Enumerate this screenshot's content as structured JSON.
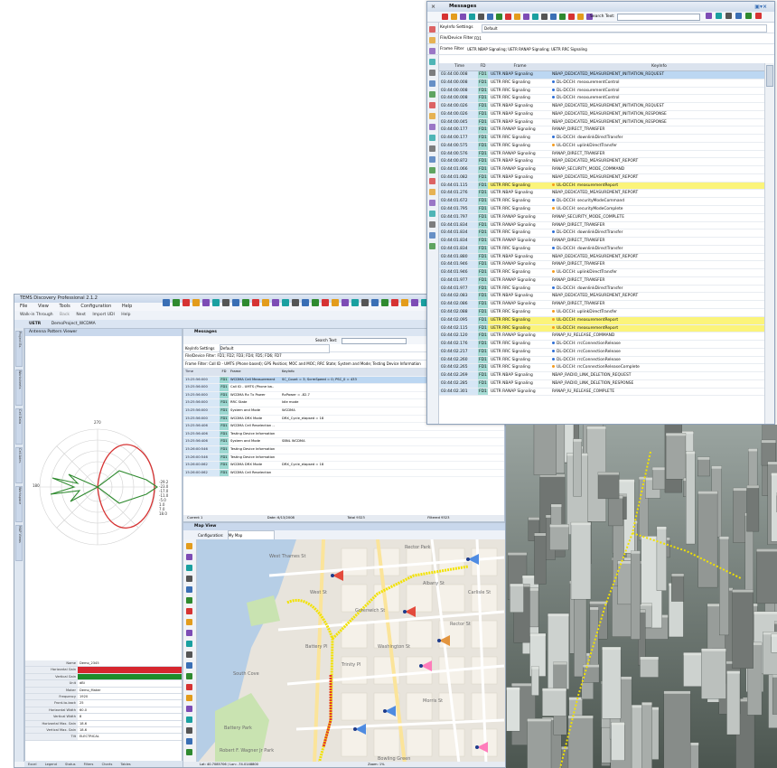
{
  "left_app": {
    "title": "TEMS Discovery Professional 2.1.2",
    "menu": [
      "File",
      "View",
      "Tools",
      "Configuration",
      "Help"
    ],
    "toolbar": {
      "walk": "Walk-in Through",
      "back": "Back",
      "next": "Next",
      "import": "Import UDI",
      "help": "Help"
    },
    "tabs": [
      "UETR",
      "DemoProject_WCDMA"
    ],
    "sidebar_tabs": [
      "Project Ex.",
      "Worksheets",
      "Cell Data",
      "Cell Adm.",
      "Workspace",
      "MAP Views"
    ],
    "antenna_panel": {
      "title": "Antenna Pattern Viewer",
      "polar_top": "270",
      "polar_left": "180",
      "ring_labels": [
        "-29.2",
        "-23.0",
        "-17.0",
        "-11.0",
        "-5.0",
        "1.0",
        "7.0",
        "18.0"
      ],
      "properties": [
        {
          "k": "Name",
          "v": "Demo_2345"
        },
        {
          "k": "Horizontal Gain",
          "v": ""
        },
        {
          "k": "Vertical Gain",
          "v": ""
        },
        {
          "k": "Unit",
          "v": "dBi"
        },
        {
          "k": "Maker",
          "v": "Demo_Maker"
        },
        {
          "k": "Frequency",
          "v": "1920"
        },
        {
          "k": "Front-to-back",
          "v": "25"
        },
        {
          "k": "Horizontal Width",
          "v": "60.0"
        },
        {
          "k": "Vertical Width",
          "v": "8"
        },
        {
          "k": "Horizontal Max. Gain",
          "v": "18.6"
        },
        {
          "k": "Vertical Max. Gain",
          "v": "18.6"
        },
        {
          "k": "Tilt",
          "v": "ELECTRICAL"
        }
      ],
      "bottom_tabs": [
        "Excel",
        "Legend",
        "Status",
        "Filters",
        "Charts",
        "Tables"
      ]
    },
    "messages_panel": {
      "title": "Messages",
      "search_label": "Search Text:",
      "keyinfo_label": "KeyInfo Settings",
      "keyinfo_value": "Default",
      "device_filter": "File/Device Filter: FD1; FD2; FD3; FD4; FD5; FD6; FD7",
      "frame_filter": "Frame Filter: Call ID - UMTS (Phone based); GPS Position; MOC and MOC; RRC State; System and Mode; Testing Device Information",
      "columns": [
        "Time",
        "FD",
        "Frame",
        "KeyInfo"
      ],
      "rows": [
        {
          "t": "15:25:56:000",
          "fd": "FD1",
          "frame": "WCDMA Cell Measurement",
          "info": "SC_Count = 3; ScrmSpeed = 0; PSC_0 = 433"
        },
        {
          "t": "15:25:56:000",
          "fd": "FD1",
          "frame": "Call ID - UMTS (Phone ba..",
          "info": ""
        },
        {
          "t": "15:25:56:000",
          "fd": "FD1",
          "frame": "WCDMA Rx Tx Power",
          "info": "RxPower = -82.7"
        },
        {
          "t": "15:25:56:000",
          "fd": "FD1",
          "frame": "RRC State",
          "info": "Idle mode"
        },
        {
          "t": "15:25:56:000",
          "fd": "FD1",
          "frame": "System and Mode",
          "info": "WCDMA"
        },
        {
          "t": "15:25:56:000",
          "fd": "FD1",
          "frame": "WCDMA DRX Mode",
          "info": "DRX_Cycle_elapsed = 18"
        },
        {
          "t": "15:25:56:406",
          "fd": "FD1",
          "frame": "WCDMA Cell Reselection ..",
          "info": ""
        },
        {
          "t": "15:25:56:406",
          "fd": "FD1",
          "frame": "Testing Device Information",
          "info": ""
        },
        {
          "t": "15:25:56:406",
          "fd": "FD1",
          "frame": "System and Mode",
          "info": "SBNL WCDMA"
        },
        {
          "t": "15:26:00:546",
          "fd": "FD1",
          "frame": "Testing Device Information",
          "info": ""
        },
        {
          "t": "15:26:00:546",
          "fd": "FD1",
          "frame": "Testing Device Information",
          "info": ""
        },
        {
          "t": "15:26:00:062",
          "fd": "FD1",
          "frame": "WCDMA DRX Mode",
          "info": "DRX_Cycle_elapsed = 18"
        },
        {
          "t": "15:26:00:062",
          "fd": "FD1",
          "frame": "WCDMA Cell Reselection",
          "info": ""
        }
      ],
      "footer": [
        "Current 1",
        "Date: 6/13/2008",
        "Total 9323",
        "Filtered 9323"
      ]
    },
    "map_view": {
      "title": "Map View",
      "config_label": "Configuration:",
      "config_value": "My Map",
      "status": "Lat: 40.7085706 / Lon: -74.0148800",
      "status_right": "Zoom: 1%",
      "labels": [
        "Battery Park",
        "South Cove",
        "Robert F. Wagner Jr Park",
        "Battery Pl",
        "West St",
        "Bowling Green",
        "Rector Park",
        "Albany St",
        "Carlisle St",
        "Trinity Pl",
        "Greenwich St",
        "Rector St",
        "Morris St",
        "Washington St",
        "West Thames St"
      ]
    }
  },
  "messages_window": {
    "title": "Messages",
    "search_label": "Search Text:",
    "keyinfo_label": "KeyInfo Settings",
    "keyinfo_value": "Default",
    "device_filter_label": "File/Device Filter",
    "device_filter_value": "FD1",
    "frame_filter_label": "Frame Filter",
    "frame_filter_value": "UETR NBAP Signaling; UETR RANAP Signaling; UETR RRC Signaling",
    "columns": [
      "Time",
      "FD",
      "Frame",
      "KeyInfo"
    ],
    "rows": [
      {
        "t": "03:44:00.008",
        "fd": "FD1",
        "frame": "UETR NBAP Signaling",
        "info": "NBAP_DEDICATED_MEASUREMENT_INITIATION_REQUEST",
        "dot": "",
        "sel": true,
        "hl": false
      },
      {
        "t": "03:44:00.008",
        "fd": "FD1",
        "frame": "UETR RRC Signaling",
        "info": "DL-DCCH: measurementControl",
        "dot": "blue",
        "sel": false,
        "hl": false
      },
      {
        "t": "03:44:00.008",
        "fd": "FD1",
        "frame": "UETR RRC Signaling",
        "info": "DL-DCCH: measurementControl",
        "dot": "blue",
        "sel": false,
        "hl": false
      },
      {
        "t": "03:44:00.008",
        "fd": "FD1",
        "frame": "UETR RRC Signaling",
        "info": "DL-DCCH: measurementControl",
        "dot": "blue",
        "sel": false,
        "hl": false
      },
      {
        "t": "03:44:00.026",
        "fd": "FD1",
        "frame": "UETR NBAP Signaling",
        "info": "NBAP_DEDICATED_MEASUREMENT_INITIATION_REQUEST",
        "dot": "",
        "sel": false,
        "hl": false
      },
      {
        "t": "03:44:00.026",
        "fd": "FD1",
        "frame": "UETR NBAP Signaling",
        "info": "NBAP_DEDICATED_MEASUREMENT_INITIATION_RESPONSE",
        "dot": "",
        "sel": false,
        "hl": false
      },
      {
        "t": "03:44:00.045",
        "fd": "FD1",
        "frame": "UETR NBAP Signaling",
        "info": "NBAP_DEDICATED_MEASUREMENT_INITIATION_RESPONSE",
        "dot": "",
        "sel": false,
        "hl": false
      },
      {
        "t": "03:44:00.177",
        "fd": "FD1",
        "frame": "UETR RANAP Signaling",
        "info": "RANAP_DIRECT_TRANSFER",
        "dot": "",
        "sel": false,
        "hl": false
      },
      {
        "t": "03:44:00.177",
        "fd": "FD1",
        "frame": "UETR RRC Signaling",
        "info": "DL-DCCH: downlinkDirectTransfer",
        "dot": "blue",
        "sel": false,
        "hl": false
      },
      {
        "t": "03:44:00.575",
        "fd": "FD1",
        "frame": "UETR RRC Signaling",
        "info": "UL-DCCH: uplinkDirectTransfer",
        "dot": "orange",
        "sel": false,
        "hl": false
      },
      {
        "t": "03:44:00.576",
        "fd": "FD1",
        "frame": "UETR RANAP Signaling",
        "info": "RANAP_DIRECT_TRANSFER",
        "dot": "",
        "sel": false,
        "hl": false
      },
      {
        "t": "03:44:00.872",
        "fd": "FD1",
        "frame": "UETR NBAP Signaling",
        "info": "NBAP_DEDICATED_MEASUREMENT_REPORT",
        "dot": "",
        "sel": false,
        "hl": false
      },
      {
        "t": "03:44:01.066",
        "fd": "FD1",
        "frame": "UETR RANAP Signaling",
        "info": "RANAP_SECURITY_MODE_COMMAND",
        "dot": "",
        "sel": false,
        "hl": false
      },
      {
        "t": "03:44:01.082",
        "fd": "FD1",
        "frame": "UETR NBAP Signaling",
        "info": "NBAP_DEDICATED_MEASUREMENT_REPORT",
        "dot": "",
        "sel": false,
        "hl": false
      },
      {
        "t": "03:44:01.115",
        "fd": "FD1",
        "frame": "UETR RRC Signaling",
        "info": "UL-DCCH: measurementReport",
        "dot": "orange",
        "sel": false,
        "hl": true
      },
      {
        "t": "03:44:01.276",
        "fd": "FD1",
        "frame": "UETR NBAP Signaling",
        "info": "NBAP_DEDICATED_MEASUREMENT_REPORT",
        "dot": "",
        "sel": false,
        "hl": false
      },
      {
        "t": "03:44:01.672",
        "fd": "FD1",
        "frame": "UETR RRC Signaling",
        "info": "DL-DCCH: securityModeCommand",
        "dot": "blue",
        "sel": false,
        "hl": false
      },
      {
        "t": "03:44:01.795",
        "fd": "FD1",
        "frame": "UETR RRC Signaling",
        "info": "UL-DCCH: securityModeComplete",
        "dot": "orange",
        "sel": false,
        "hl": false
      },
      {
        "t": "03:44:01.797",
        "fd": "FD1",
        "frame": "UETR RANAP Signaling",
        "info": "RANAP_SECURITY_MODE_COMPLETE",
        "dot": "",
        "sel": false,
        "hl": false
      },
      {
        "t": "03:44:01.834",
        "fd": "FD1",
        "frame": "UETR RANAP Signaling",
        "info": "RANAP_DIRECT_TRANSFER",
        "dot": "",
        "sel": false,
        "hl": false
      },
      {
        "t": "03:44:01.834",
        "fd": "FD1",
        "frame": "UETR RRC Signaling",
        "info": "DL-DCCH: downlinkDirectTransfer",
        "dot": "blue",
        "sel": false,
        "hl": false
      },
      {
        "t": "03:44:01.834",
        "fd": "FD1",
        "frame": "UETR RANAP Signaling",
        "info": "RANAP_DIRECT_TRANSFER",
        "dot": "",
        "sel": false,
        "hl": false
      },
      {
        "t": "03:44:01.834",
        "fd": "FD1",
        "frame": "UETR RRC Signaling",
        "info": "DL-DCCH: downlinkDirectTransfer",
        "dot": "blue",
        "sel": false,
        "hl": false
      },
      {
        "t": "03:44:01.880",
        "fd": "FD1",
        "frame": "UETR NBAP Signaling",
        "info": "NBAP_DEDICATED_MEASUREMENT_REPORT",
        "dot": "",
        "sel": false,
        "hl": false
      },
      {
        "t": "03:44:01.946",
        "fd": "FD1",
        "frame": "UETR RANAP Signaling",
        "info": "RANAP_DIRECT_TRANSFER",
        "dot": "",
        "sel": false,
        "hl": false
      },
      {
        "t": "03:44:01.946",
        "fd": "FD1",
        "frame": "UETR RRC Signaling",
        "info": "UL-DCCH: uplinkDirectTransfer",
        "dot": "orange",
        "sel": false,
        "hl": false
      },
      {
        "t": "03:44:01.977",
        "fd": "FD1",
        "frame": "UETR RANAP Signaling",
        "info": "RANAP_DIRECT_TRANSFER",
        "dot": "",
        "sel": false,
        "hl": false
      },
      {
        "t": "03:44:01.977",
        "fd": "FD1",
        "frame": "UETR RRC Signaling",
        "info": "DL-DCCH: downlinkDirectTransfer",
        "dot": "blue",
        "sel": false,
        "hl": false
      },
      {
        "t": "03:44:02.083",
        "fd": "FD1",
        "frame": "UETR NBAP Signaling",
        "info": "NBAP_DEDICATED_MEASUREMENT_REPORT",
        "dot": "",
        "sel": false,
        "hl": false
      },
      {
        "t": "03:44:02.086",
        "fd": "FD1",
        "frame": "UETR RANAP Signaling",
        "info": "RANAP_DIRECT_TRANSFER",
        "dot": "",
        "sel": false,
        "hl": false
      },
      {
        "t": "03:44:02.088",
        "fd": "FD1",
        "frame": "UETR RRC Signaling",
        "info": "UL-DCCH: uplinkDirectTransfer",
        "dot": "orange",
        "sel": false,
        "hl": false
      },
      {
        "t": "03:44:02.095",
        "fd": "FD1",
        "frame": "UETR RRC Signaling",
        "info": "UL-DCCH: measurementReport",
        "dot": "orange",
        "sel": false,
        "hl": true
      },
      {
        "t": "03:44:02.115",
        "fd": "FD1",
        "frame": "UETR RRC Signaling",
        "info": "UL-DCCH: measurementReport",
        "dot": "orange",
        "sel": false,
        "hl": true
      },
      {
        "t": "03:44:02.120",
        "fd": "FD1",
        "frame": "UETR RANAP Signaling",
        "info": "RANAP_IU_RELEASE_COMMAND",
        "dot": "",
        "sel": false,
        "hl": false
      },
      {
        "t": "03:44:02.176",
        "fd": "FD1",
        "frame": "UETR RRC Signaling",
        "info": "DL-DCCH: rrcConnectionRelease",
        "dot": "blue",
        "sel": false,
        "hl": false
      },
      {
        "t": "03:44:02.217",
        "fd": "FD1",
        "frame": "UETR RRC Signaling",
        "info": "DL-DCCH: rrcConnectionRelease",
        "dot": "blue",
        "sel": false,
        "hl": false
      },
      {
        "t": "03:44:02.260",
        "fd": "FD1",
        "frame": "UETR RRC Signaling",
        "info": "DL-DCCH: rrcConnectionRelease",
        "dot": "blue",
        "sel": false,
        "hl": false
      },
      {
        "t": "03:44:02.265",
        "fd": "FD1",
        "frame": "UETR RRC Signaling",
        "info": "UL-DCCH: rrcConnectionReleaseComplete",
        "dot": "orange",
        "sel": false,
        "hl": false
      },
      {
        "t": "03:44:02.269",
        "fd": "FD1",
        "frame": "UETR NBAP Signaling",
        "info": "NBAP_RADIO_LINK_DELETION_REQUEST",
        "dot": "",
        "sel": false,
        "hl": false
      },
      {
        "t": "03:44:02.285",
        "fd": "FD1",
        "frame": "UETR NBAP Signaling",
        "info": "NBAP_RADIO_LINK_DELETION_RESPONSE",
        "dot": "",
        "sel": false,
        "hl": false
      },
      {
        "t": "03:44:02.301",
        "fd": "FD1",
        "frame": "UETR RANAP Signaling",
        "info": "RANAP_IU_RELEASE_COMPLETE",
        "dot": "",
        "sel": false,
        "hl": false
      }
    ]
  },
  "colors": {
    "accent": "#bcd7f2",
    "highlight": "#fbf47a",
    "time_col": "#d6e6f5",
    "fd_col": "#a6dcd5",
    "dl_dot": "#2f6fd6",
    "ul_dot": "#f39b1f",
    "route_yellow": "#f2e200",
    "route_red": "#e23a2b"
  }
}
